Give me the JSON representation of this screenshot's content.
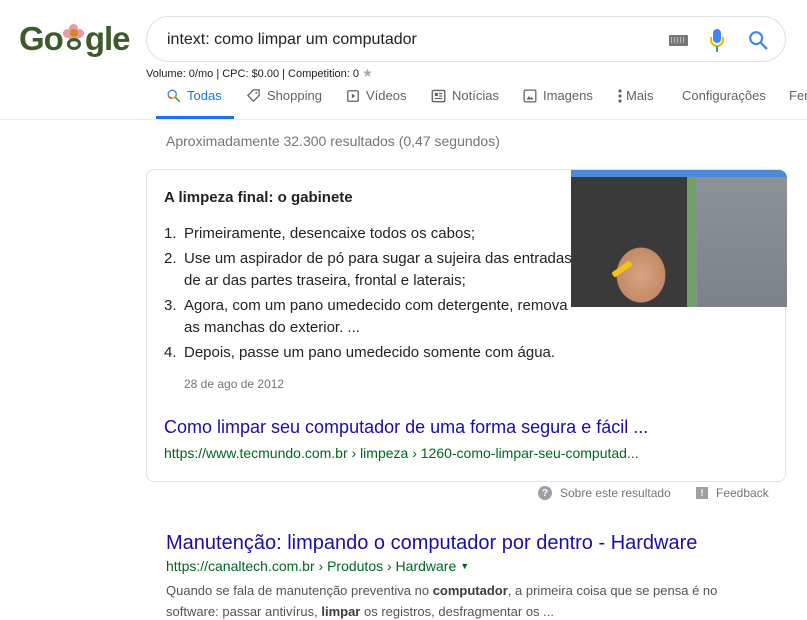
{
  "logo": {
    "text_before": "Go",
    "text_after": "gle",
    "alt": "Google"
  },
  "search": {
    "query": "intext: como limpar um computador",
    "placeholder": ""
  },
  "keyword_stats": {
    "text": "Volume: 0/mo | CPC: $0.00 | Competition: 0"
  },
  "tabs": [
    {
      "label": "Todas",
      "icon": "search-icon",
      "active": true
    },
    {
      "label": "Shopping",
      "icon": "tag-icon"
    },
    {
      "label": "Vídeos",
      "icon": "play-icon"
    },
    {
      "label": "Notícias",
      "icon": "news-icon"
    },
    {
      "label": "Imagens",
      "icon": "image-icon"
    },
    {
      "label": "Mais",
      "icon": "more-vert-icon"
    },
    {
      "label": "Configurações"
    },
    {
      "label": "Fer"
    }
  ],
  "result_stats": "Aproximadamente 32.300 resultados (0,47 segundos)",
  "featured_snippet": {
    "title": "A limpeza final: o gabinete",
    "items": [
      {
        "num": "1.",
        "text": "Primeiramente, desencaixe todos os cabos;"
      },
      {
        "num": "2.",
        "text": "Use um aspirador de pó para sugar a sujeira das entradas de ar das partes traseira, frontal e laterais;"
      },
      {
        "num": "3.",
        "text": "Agora, com um pano umedecido com detergente, remova as manchas do exterior. ..."
      },
      {
        "num": "4.",
        "text": "Depois, passe um pano umedecido somente com água."
      }
    ],
    "date": "28 de ago de 2012",
    "link_title": "Como limpar seu computador de uma forma segura e fácil ...",
    "url": "https://www.tecmundo.com.br › limpeza › 1260-como-limpar-seu-computad...",
    "image_alt": "hand cleaning computer case"
  },
  "snippet_footer": {
    "about_label": "Sobre este resultado",
    "feedback_label": "Feedback"
  },
  "result2": {
    "title": "Manutenção: limpando o computador por dentro - Hardware",
    "url": "https://canaltech.com.br › Produtos › Hardware",
    "desc_parts": [
      {
        "text": "Quando se fala de manutenção preventiva no ",
        "bold": false
      },
      {
        "text": "computador",
        "bold": true
      },
      {
        "text": ", a primeira coisa que se pensa é no software: passar antivírus, ",
        "bold": false
      },
      {
        "text": "limpar",
        "bold": true
      },
      {
        "text": " os registros, desfragmentar os ...",
        "bold": false
      }
    ]
  },
  "colors": {
    "link": "#1a0dab",
    "url": "#006621",
    "active_tab": "#1a73e8",
    "muted": "#70757a"
  }
}
